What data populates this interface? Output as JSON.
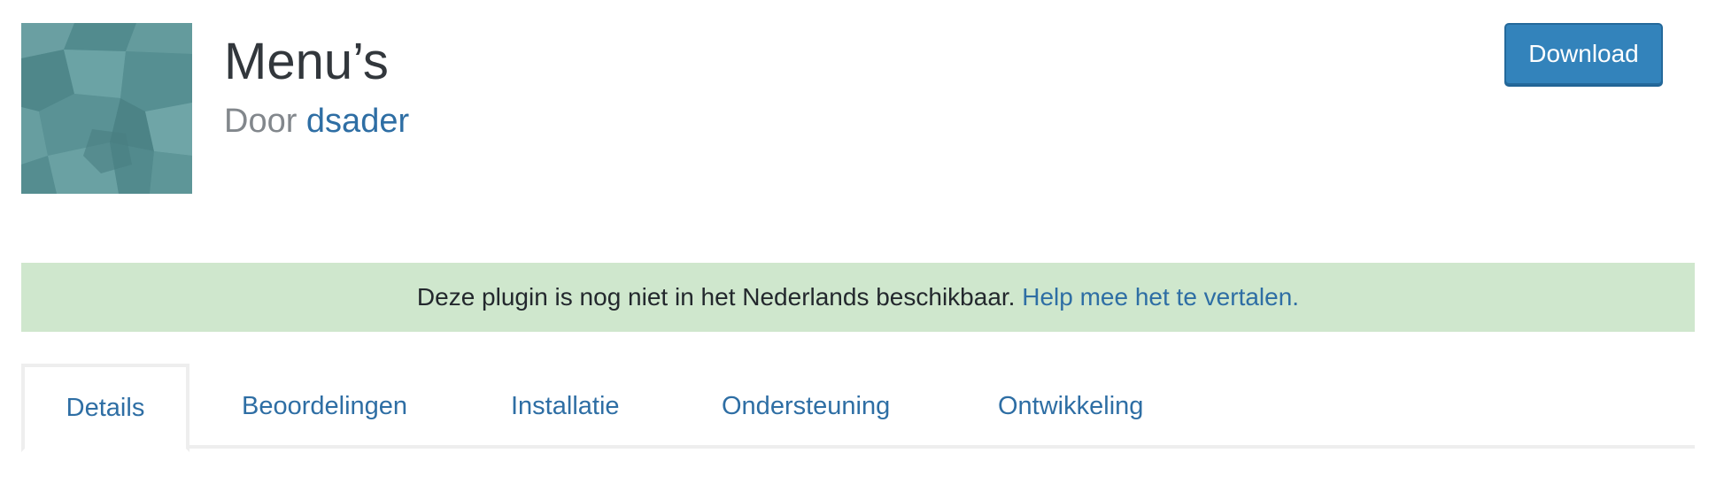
{
  "plugin": {
    "title": "Menu’s",
    "by_prefix": "Door ",
    "author": "dsader"
  },
  "actions": {
    "download_label": "Download"
  },
  "notice": {
    "text": "Deze plugin is nog niet in het Nederlands beschikbaar. ",
    "link": "Help mee het te vertalen."
  },
  "tabs": [
    {
      "label": "Details",
      "active": true
    },
    {
      "label": "Beoordelingen",
      "active": false
    },
    {
      "label": "Installatie",
      "active": false
    },
    {
      "label": "Ondersteuning",
      "active": false
    },
    {
      "label": "Ontwikkeling",
      "active": false
    }
  ],
  "colors": {
    "link": "#2e6ea4",
    "button": "#3383bb",
    "notice_bg": "#cfe7cd",
    "icon_base": "#5b9396"
  },
  "icons": {
    "plugin_icon": "geometric-pattern-icon"
  }
}
